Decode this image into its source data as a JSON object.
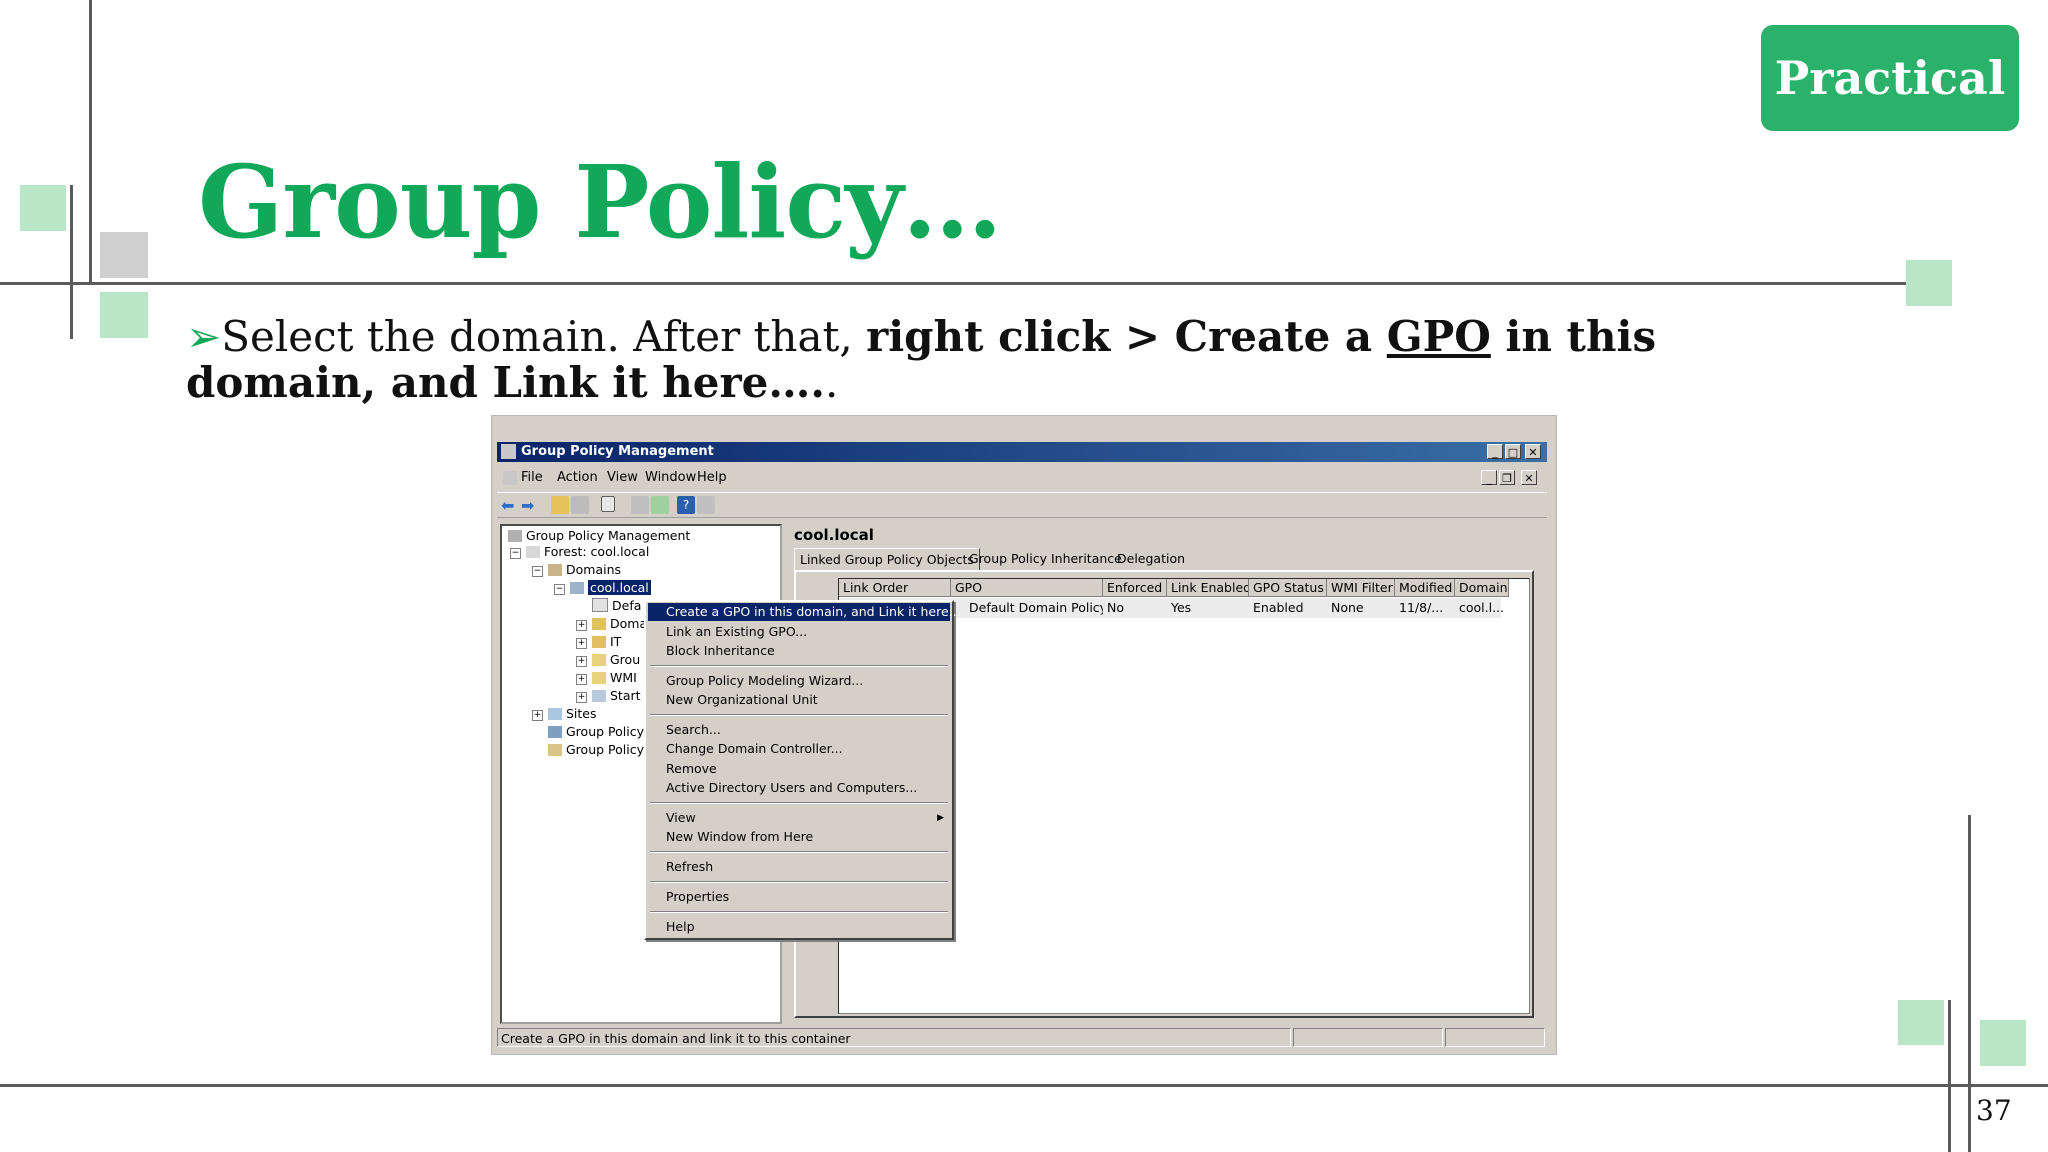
{
  "badge": "Practical",
  "slide_title": "Group Policy…",
  "bullet": {
    "marker": "➢",
    "part1": "Select the domain. After that, ",
    "bold1": "right click > Create a ",
    "bold_underline": "GPO",
    "bold2": " in this domain, and Link it here….",
    "tail": "."
  },
  "page_number": "37",
  "window": {
    "title": "Group Policy Management",
    "menu": [
      "File",
      "Action",
      "View",
      "Window",
      "Help"
    ],
    "tree": [
      {
        "label": "Group Policy Management",
        "icon": "gpm-icon"
      },
      {
        "label": "Forest: cool.local",
        "icon": "forest-icon"
      },
      {
        "label": "Domains",
        "icon": "domains-icon"
      },
      {
        "label": "cool.local",
        "icon": "domain-icon",
        "selected": true
      },
      {
        "label": "Defa",
        "icon": "gpo-link-icon"
      },
      {
        "label": "Doma",
        "icon": "ou-icon"
      },
      {
        "label": "IT",
        "icon": "ou-icon"
      },
      {
        "label": "Grou",
        "icon": "folder-icon"
      },
      {
        "label": "WMI",
        "icon": "folder-icon"
      },
      {
        "label": "Start",
        "icon": "folder-icon"
      },
      {
        "label": "Sites",
        "icon": "sites-icon"
      },
      {
        "label": "Group Policy",
        "icon": "modeling-icon"
      },
      {
        "label": "Group Policy",
        "icon": "results-icon"
      }
    ],
    "right_title": "cool.local",
    "tabs": [
      "Linked Group Policy Objects",
      "Group Policy Inheritance",
      "Delegation"
    ],
    "columns": [
      "Link Order",
      "GPO",
      "Enforced",
      "Link Enabled",
      "GPO Status",
      "WMI Filter",
      "Modified",
      "Domain"
    ],
    "row": {
      "gpo": "Default Domain Policy",
      "enforced": "No",
      "link_enabled": "Yes",
      "status": "Enabled",
      "wmi": "None",
      "modified": "11/8/...",
      "domain": "cool.l..."
    },
    "status_text": "Create a GPO in this domain and link it to this container",
    "context_menu": [
      "Create a GPO in this domain, and Link it here...",
      "Link an Existing GPO...",
      "Block Inheritance",
      "Group Policy Modeling Wizard...",
      "New Organizational Unit",
      "Search...",
      "Change Domain Controller...",
      "Remove",
      "Active Directory Users and Computers...",
      "View",
      "New Window from Here",
      "Refresh",
      "Properties",
      "Help"
    ]
  },
  "colors": {
    "accent": "#12a859",
    "badge": "#2ab26a",
    "line": "#5b5b5b",
    "square_green": "#b9e6c7",
    "square_gray": "#cfcfcf"
  }
}
